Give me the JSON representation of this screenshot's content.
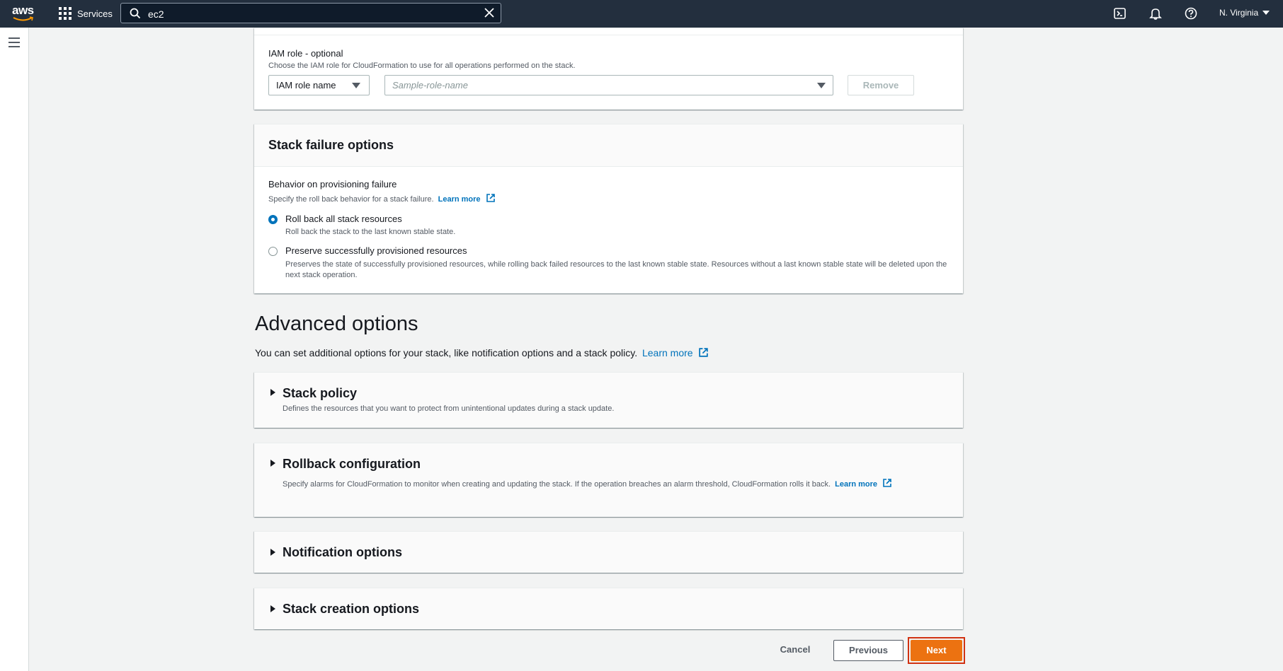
{
  "topbar": {
    "logo_text": "aws",
    "services_label": "Services",
    "search_value": "ec2",
    "region_label": "N. Virginia"
  },
  "iam": {
    "label": "IAM role - optional",
    "description": "Choose the IAM role for CloudFormation to use for all operations performed on the stack.",
    "type_select_value": "IAM role name",
    "role_placeholder": "Sample-role-name",
    "remove_label": "Remove"
  },
  "stack_failure": {
    "title": "Stack failure options",
    "behavior_label": "Behavior on provisioning failure",
    "behavior_desc": "Specify the roll back behavior for a stack failure.",
    "learn_more": "Learn more",
    "options": [
      {
        "label": "Roll back all stack resources",
        "desc": "Roll back the stack to the last known stable state.",
        "selected": true
      },
      {
        "label": "Preserve successfully provisioned resources",
        "desc": "Preserves the state of successfully provisioned resources, while rolling back failed resources to the last known stable state. Resources without a last known stable state will be deleted upon the next stack operation.",
        "selected": false
      }
    ]
  },
  "advanced": {
    "heading": "Advanced options",
    "intro": "You can set additional options for your stack, like notification options and a stack policy.",
    "learn_more": "Learn more",
    "sections": [
      {
        "title": "Stack policy",
        "desc": "Defines the resources that you want to protect from unintentional updates during a stack update."
      },
      {
        "title": "Rollback configuration",
        "desc": "Specify alarms for CloudFormation to monitor when creating and updating the stack. If the operation breaches an alarm threshold, CloudFormation rolls it back.",
        "learn_more": "Learn more"
      },
      {
        "title": "Notification options"
      },
      {
        "title": "Stack creation options"
      }
    ]
  },
  "footer": {
    "cancel_label": "Cancel",
    "previous_label": "Previous",
    "next_label": "Next"
  },
  "colors": {
    "topbar": "#232f3e",
    "link": "#0073bb",
    "primary_button": "#ec7211",
    "highlight_outline": "#d13212"
  }
}
